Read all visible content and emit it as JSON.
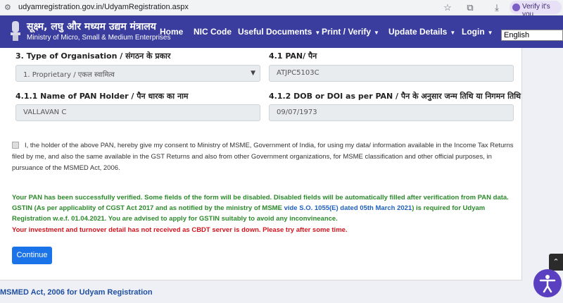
{
  "browser": {
    "url": "udyamregistration.gov.in/UdyamRegistration.aspx",
    "verify_label": "Verify it's you"
  },
  "header": {
    "ministry_hindi": "सूक्ष्म, लघु और मध्यम उद्यम मंत्रालय",
    "ministry_english": "Ministry of Micro, Small & Medium Enterprises",
    "nav": [
      {
        "label": "Home"
      },
      {
        "label": "NIC Code"
      },
      {
        "label": "Useful Documents"
      },
      {
        "label": "Print / Verify"
      },
      {
        "label": "Update Details"
      },
      {
        "label": "Login"
      }
    ],
    "language": "English"
  },
  "form": {
    "org_type_label": "3. Type of Organisation / संगठन के प्रकार",
    "org_type_value": "1. Proprietary / एकल स्वामित्व",
    "pan_label": "4.1 PAN/ पैन",
    "pan_value": "ATJPC5103C",
    "pan_holder_label": "4.1.1 Name of PAN Holder / पैन धारक का नाम",
    "pan_holder_value": "VALLAVAN C",
    "dob_label": "4.1.2 DOB or DOI as per PAN / पैन के अनुसार जन्म तिथि या निगमन तिथि",
    "dob_value": "09/07/1973",
    "consent_text": "I, the holder of the above PAN, hereby give my consent to Ministry of MSME, Government of India, for using my data/ information available in the Income Tax Returns filed by me, and also the same available in the GST Returns and also from other Government organizations, for MSME classification and other official purposes, in pursuance of the MSMED Act, 2006."
  },
  "messages": {
    "pan_verified": "Your PAN has been successfully verified. Some fields of the form will be disabled. Disabled fields will be automatically filled after verification from PAN data.",
    "gstin_part1": "GSTIN (As per applicablity of CGST Act 2017 and as notified by the ministry of MSME ",
    "gstin_link": "vide S.O. 1055(E) dated 05th March 2021",
    "gstin_part2": ") is required for Udyam Registration w.e.f. 01.04.2021. You are advised to apply for GSTIN suitably to avoid any inconvineance.",
    "cbdt_error": "Your investment and turnover detail has not received as CBDT server is down. Please try after some time."
  },
  "actions": {
    "continue_label": "Continue"
  },
  "footer": {
    "text": "MSMED Act, 2006 for Udyam Registration"
  },
  "icons": {
    "up_arrow": "⌃"
  },
  "colors": {
    "navbar": "#3a3d9e",
    "success": "#2a8a2a",
    "link": "#1f5fbf",
    "error": "#d4141c",
    "primary_button": "#1a73e8"
  }
}
